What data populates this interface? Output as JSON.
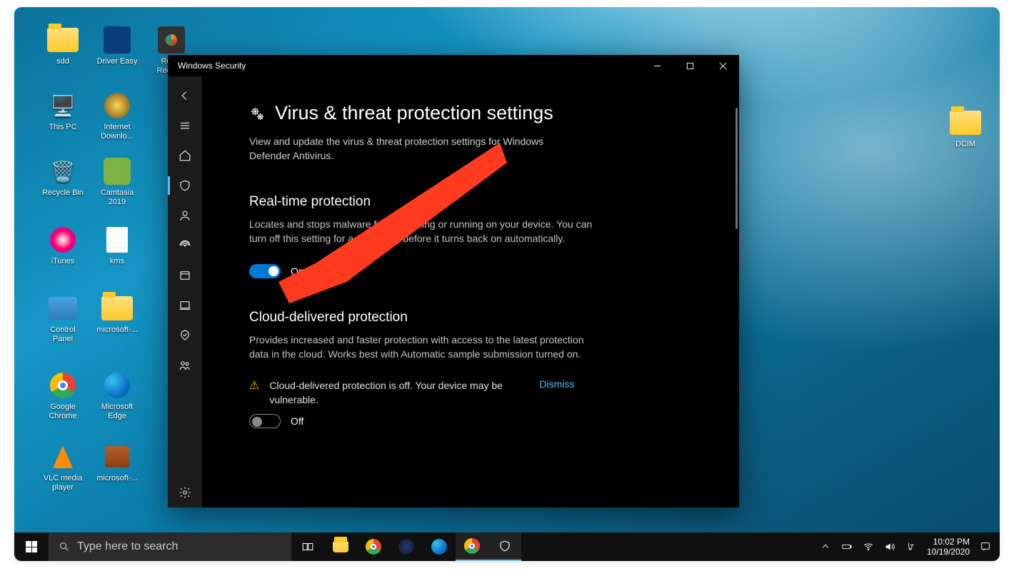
{
  "desktop_icons": {
    "sdd": "sdd",
    "driver_easy": "Driver Easy",
    "remo_recover": "Remo\nRecover",
    "this_pc": "This PC",
    "internet_download": "Internet\nDownlo...",
    "recycle_bin": "Recycle Bin",
    "camtasia": "Camtasia\n2019",
    "itunes": "iTunes",
    "kms": "kms",
    "control_panel": "Control\nPanel",
    "microsoft1": "microsoft-...",
    "chrome": "Google\nChrome",
    "edge": "Microsoft\nEdge",
    "vlc": "VLC media\nplayer",
    "microsoft2": "microsoft-...",
    "dcim": "DCIM"
  },
  "window": {
    "title": "Windows Security",
    "page_title": "Virus & threat protection settings",
    "page_subtitle": "View and update the virus & threat protection settings for Windows Defender Antivirus.",
    "section1": {
      "heading": "Real-time protection",
      "desc": "Locates and stops malware from installing or running on your device. You can turn off this setting for a short time before it turns back on automatically.",
      "toggle_state": "On"
    },
    "section2": {
      "heading": "Cloud-delivered protection",
      "desc": "Provides increased and faster protection with access to the latest protection data in the cloud. Works best with Automatic sample submission turned on.",
      "warn_text": "Cloud-delivered protection is off. Your device may be vulnerable.",
      "dismiss": "Dismiss",
      "toggle_state": "Off"
    }
  },
  "taskbar": {
    "search_placeholder": "Type here to search",
    "time": "10:02 PM",
    "date": "10/19/2020"
  }
}
